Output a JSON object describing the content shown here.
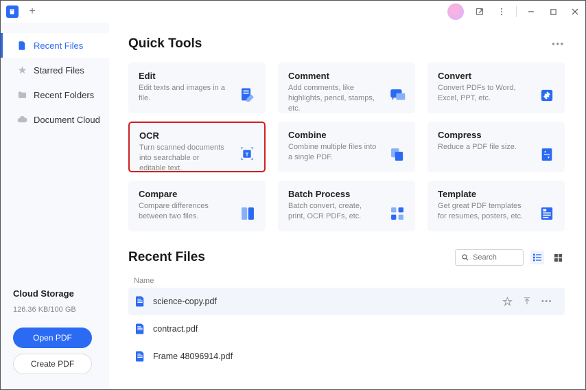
{
  "sidebar": {
    "items": [
      {
        "label": "Recent Files",
        "active": true
      },
      {
        "label": "Starred Files",
        "active": false
      },
      {
        "label": "Recent Folders",
        "active": false
      },
      {
        "label": "Document Cloud",
        "active": false
      }
    ],
    "cloud_title": "Cloud Storage",
    "cloud_usage": "126.36 KB/100 GB",
    "open_label": "Open PDF",
    "create_label": "Create PDF"
  },
  "quick_tools": {
    "title": "Quick Tools",
    "tools": [
      {
        "title": "Edit",
        "desc": "Edit texts and images in a file."
      },
      {
        "title": "Comment",
        "desc": "Add comments, like highlights, pencil, stamps, etc."
      },
      {
        "title": "Convert",
        "desc": "Convert PDFs to Word, Excel, PPT, etc."
      },
      {
        "title": "OCR",
        "desc": "Turn scanned documents into searchable or editable text."
      },
      {
        "title": "Combine",
        "desc": "Combine multiple files into a single PDF."
      },
      {
        "title": "Compress",
        "desc": "Reduce a PDF file size."
      },
      {
        "title": "Compare",
        "desc": "Compare differences between two files."
      },
      {
        "title": "Batch Process",
        "desc": "Batch convert, create, print, OCR PDFs, etc."
      },
      {
        "title": "Template",
        "desc": "Get great PDF templates for resumes, posters, etc."
      }
    ]
  },
  "recent": {
    "title": "Recent Files",
    "col_name": "Name",
    "search_placeholder": "Search",
    "files": [
      {
        "name": "science-copy.pdf",
        "hovered": true
      },
      {
        "name": "contract.pdf",
        "hovered": false
      },
      {
        "name": "Frame 48096914.pdf",
        "hovered": false
      }
    ]
  }
}
